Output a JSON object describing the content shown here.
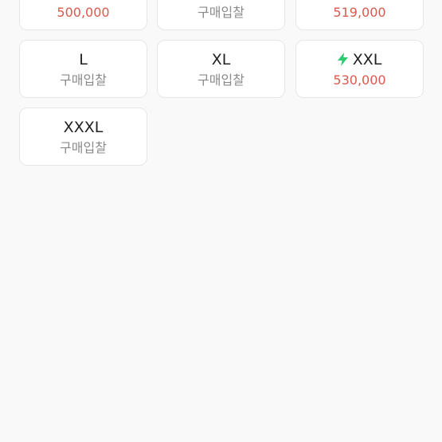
{
  "colors": {
    "background": "#f9f9f9",
    "card_background": "#ffffff",
    "card_border": "#e6e6e6",
    "price": "#d95a4e",
    "bid_text": "#8a8a8a",
    "fast_delivery": "#2ecc71"
  },
  "size_cards": [
    {
      "size": "",
      "sub": "500,000",
      "sub_type": "price",
      "fast_delivery_icon": false
    },
    {
      "size": "",
      "sub": "구매입찰",
      "sub_type": "bid",
      "fast_delivery_icon": false
    },
    {
      "size": "",
      "sub": "519,000",
      "sub_type": "price",
      "fast_delivery_icon": false
    },
    {
      "size": "L",
      "sub": "구매입찰",
      "sub_type": "bid",
      "fast_delivery_icon": false
    },
    {
      "size": "XL",
      "sub": "구매입찰",
      "sub_type": "bid",
      "fast_delivery_icon": false
    },
    {
      "size": "XXL",
      "sub": "530,000",
      "sub_type": "price",
      "fast_delivery_icon": true,
      "icon": "lightning-bolt-icon"
    },
    {
      "size": "XXXL",
      "sub": "구매입찰",
      "sub_type": "bid",
      "fast_delivery_icon": false
    }
  ]
}
